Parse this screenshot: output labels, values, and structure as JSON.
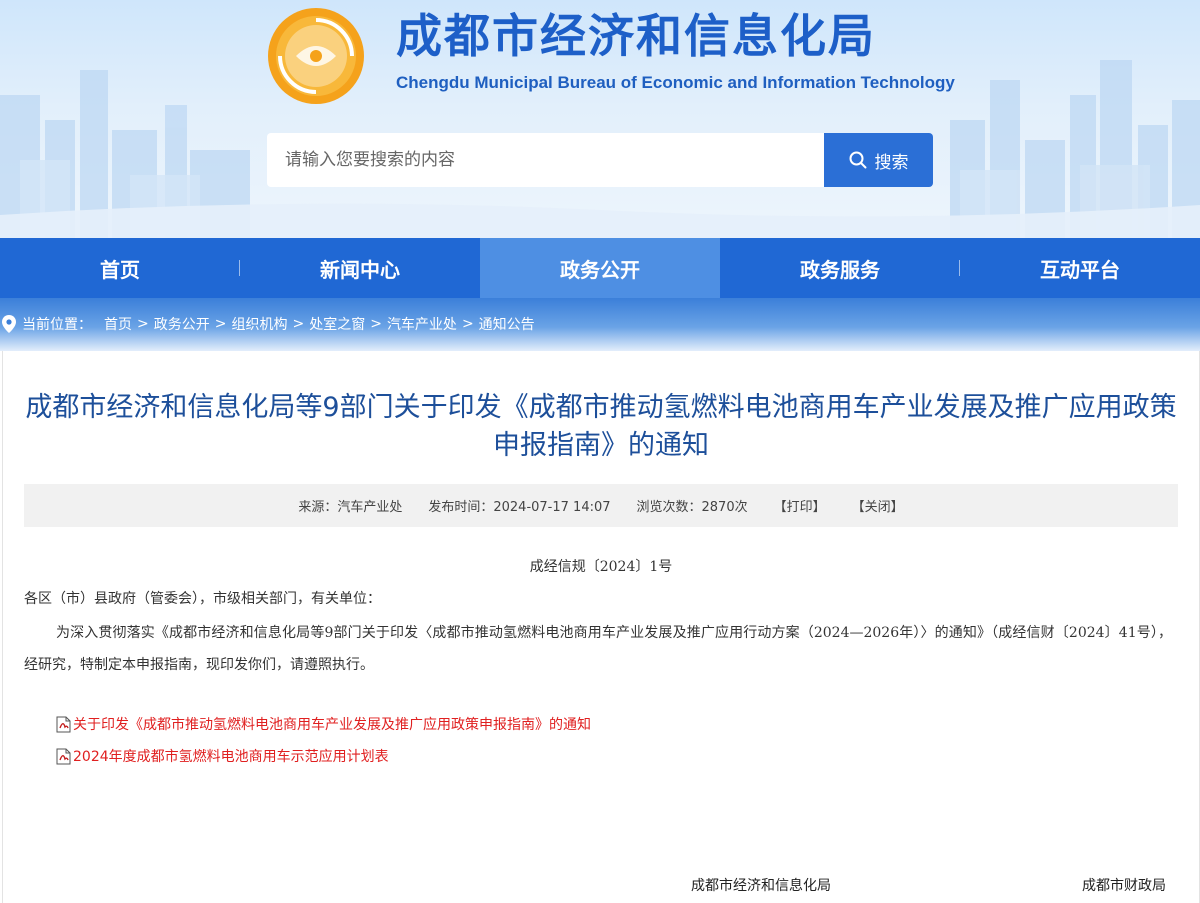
{
  "header": {
    "site_title": "成都市经济和信息化局",
    "site_subtitle": "Chengdu Municipal Bureau of Economic and Information Technology",
    "search_placeholder": "请输入您要搜索的内容",
    "search_button": "搜索"
  },
  "nav": {
    "items": [
      {
        "label": "首页",
        "active": false
      },
      {
        "label": "新闻中心",
        "active": false
      },
      {
        "label": "政务公开",
        "active": true
      },
      {
        "label": "政务服务",
        "active": false
      },
      {
        "label": "互动平台",
        "active": false
      }
    ]
  },
  "breadcrumb": {
    "label": "当前位置：",
    "items": [
      "首页",
      "政务公开",
      "组织机构",
      "处室之窗",
      "汽车产业处",
      "通知公告"
    ],
    "separator": ">"
  },
  "article": {
    "title": "成都市经济和信息化局等9部门关于印发《成都市推动氢燃料电池商用车产业发展及推广应用政策申报指南》的通知",
    "meta": {
      "source": "来源：汽车产业处",
      "published": "发布时间：2024-07-17 14:07",
      "views": "浏览次数：2870次",
      "print": "【打印】",
      "close": "【关闭】"
    },
    "doc_number": "成经信规〔2024〕1号",
    "addressee": "各区（市）县政府（管委会），市级相关部门，有关单位：",
    "body": "为深入贯彻落实《成都市经济和信息化局等9部门关于印发〈成都市推动氢燃料电池商用车产业发展及推广应用行动方案（2024—2026年）〉的通知》（成经信财〔2024〕41号），经研究，特制定本申报指南，现印发你们，请遵照执行。",
    "attachments": [
      "关于印发《成都市推动氢燃料电池商用车产业发展及推广应用政策申报指南》的通知",
      "2024年度成都市氢燃料电池商用车示范应用计划表"
    ],
    "signatures": [
      "成都市经济和信息化局",
      "成都市财政局"
    ]
  },
  "colors": {
    "nav_bg": "#2068d4",
    "nav_active": "#4e8fe3",
    "title_blue": "#1d4f9a",
    "link_red": "#e02020"
  }
}
